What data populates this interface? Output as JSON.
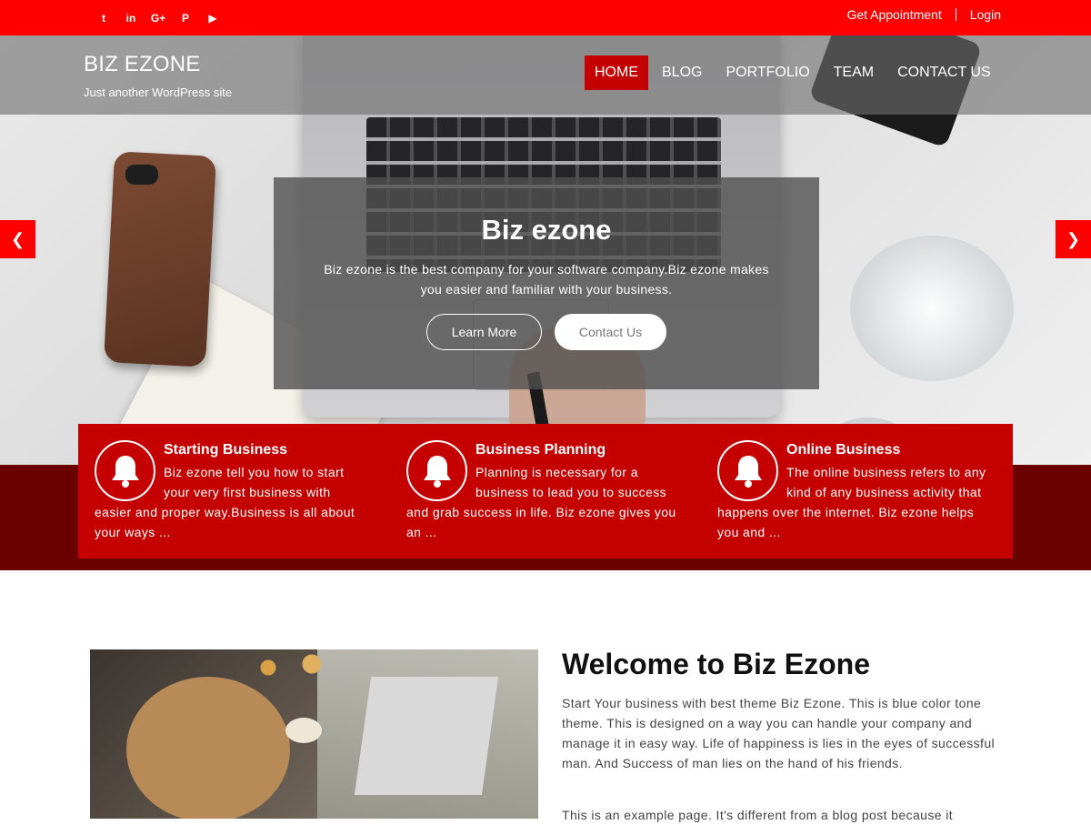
{
  "topbar": {
    "social": [
      {
        "icon": "twitter-icon",
        "glyph": "t"
      },
      {
        "icon": "linkedin-icon",
        "glyph": "in"
      },
      {
        "icon": "google-plus-icon",
        "glyph": "G+"
      },
      {
        "icon": "pinterest-icon",
        "glyph": "P"
      },
      {
        "icon": "youtube-icon",
        "glyph": "▶"
      }
    ],
    "appointment_label": "Get Appointment",
    "login_label": "Login"
  },
  "header": {
    "site_title": "BIZ EZONE",
    "site_description": "Just another WordPress site",
    "nav": [
      "HOME",
      "BLOG",
      "PORTFOLIO",
      "TEAM",
      "CONTACT US"
    ],
    "active_nav": "HOME"
  },
  "slider": {
    "title": "Biz ezone",
    "text": "Biz ezone is the best company for your software company.Biz ezone makes you easier and familiar with your business.",
    "learn_more": "Learn More",
    "contact_us": "Contact Us",
    "prev_glyph": "❮",
    "next_glyph": "❯"
  },
  "features": [
    {
      "title": "Starting Business",
      "text": "Biz ezone tell you how to start your very first business with easier and proper way.Business is all about your ways ..."
    },
    {
      "title": "Business Planning",
      "text": "Planning is necessary for a business to lead you to success and grab success in life. Biz ezone gives you an ..."
    },
    {
      "title": "Online Business",
      "text": "The online business refers to any kind of any business activity that happens over the internet. Biz ezone helps you and ..."
    }
  ],
  "welcome": {
    "title": "Welcome to Biz Ezone",
    "text": "Start Your business with best theme Biz Ezone. This is blue color tone theme. This is designed on a way you can handle your company and manage it in easy way. Life of happiness is lies in the eyes of successful man. And Success of man lies on the hand of his friends.",
    "text2": "This is an example page. It's different from a blog post because it"
  },
  "colors": {
    "topbar": "#ff0000",
    "nav_active": "#c50000",
    "feature_box": "#c50000",
    "band": "#6b0000"
  }
}
